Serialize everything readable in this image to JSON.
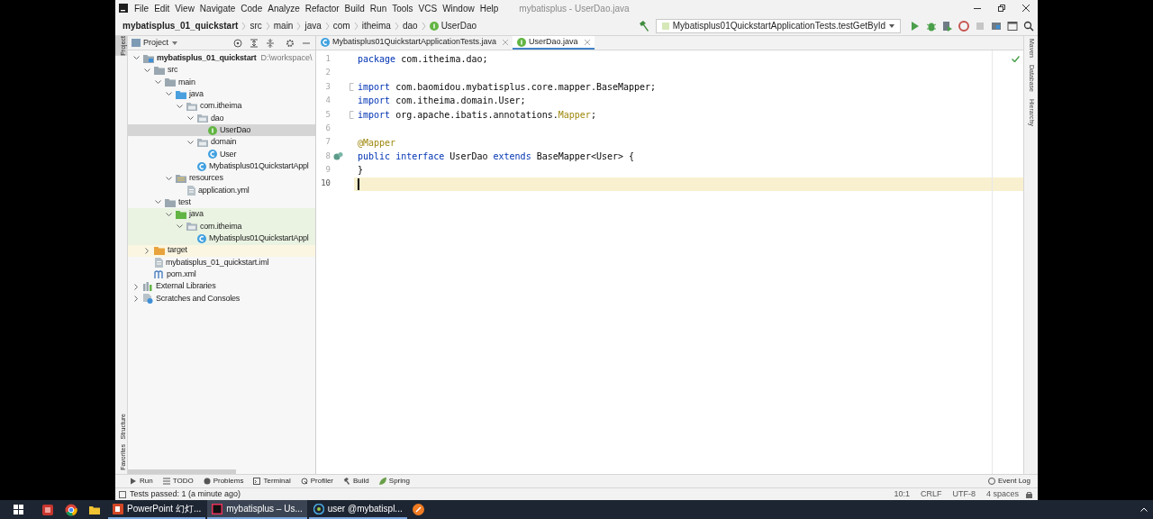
{
  "menu": [
    "File",
    "Edit",
    "View",
    "Navigate",
    "Code",
    "Analyze",
    "Refactor",
    "Build",
    "Run",
    "Tools",
    "VCS",
    "Window",
    "Help"
  ],
  "window": {
    "title": "mybatisplus - UserDao.java"
  },
  "breadcrumbs": [
    {
      "label": "mybatisplus_01_quickstart",
      "kind": "project"
    },
    {
      "label": "src",
      "kind": "folder"
    },
    {
      "label": "main",
      "kind": "folder"
    },
    {
      "label": "java",
      "kind": "folder"
    },
    {
      "label": "com",
      "kind": "folder"
    },
    {
      "label": "itheima",
      "kind": "folder"
    },
    {
      "label": "dao",
      "kind": "folder"
    },
    {
      "label": "UserDao",
      "kind": "interface"
    }
  ],
  "run_config": {
    "label": "Mybatisplus01QuickstartApplicationTests.testGetById"
  },
  "left_stripe_top": [
    {
      "label": "Project",
      "selected": true
    }
  ],
  "left_stripe_bottom": [
    {
      "label": "Structure",
      "selected": false
    },
    {
      "label": "Favorites",
      "selected": false
    }
  ],
  "project_panel": {
    "title": "Project",
    "tree": [
      {
        "label": "mybatisplus_01_quickstart",
        "kind": "module",
        "hint": "D:\\workspace\\",
        "expanded": true,
        "selected": false,
        "children": [
          {
            "label": "src",
            "kind": "folder",
            "expanded": true,
            "selected": false,
            "children": [
              {
                "label": "main",
                "kind": "folder",
                "expanded": true,
                "selected": false,
                "children": [
                  {
                    "label": "java",
                    "kind": "source-folder",
                    "expanded": true,
                    "selected": false,
                    "children": [
                      {
                        "label": "com.itheima",
                        "kind": "package",
                        "expanded": true,
                        "selected": false,
                        "children": [
                          {
                            "label": "dao",
                            "kind": "package",
                            "expanded": true,
                            "selected": false,
                            "children": [
                              {
                                "label": "UserDao",
                                "kind": "interface",
                                "selected": true
                              }
                            ]
                          },
                          {
                            "label": "domain",
                            "kind": "package",
                            "expanded": true,
                            "selected": false,
                            "children": [
                              {
                                "label": "User",
                                "kind": "class",
                                "selected": false
                              }
                            ]
                          },
                          {
                            "label": "Mybatisplus01QuickstartAppl",
                            "kind": "class",
                            "selected": false
                          }
                        ]
                      }
                    ]
                  },
                  {
                    "label": "resources",
                    "kind": "resources",
                    "expanded": true,
                    "selected": false,
                    "children": [
                      {
                        "label": "application.yml",
                        "kind": "file",
                        "selected": false
                      }
                    ]
                  }
                ]
              },
              {
                "label": "test",
                "kind": "folder",
                "expanded": true,
                "selected": false,
                "children": [
                  {
                    "label": "java",
                    "kind": "test-folder",
                    "color": "#eaf3e2",
                    "expanded": true,
                    "selected": false,
                    "children": [
                      {
                        "label": "com.itheima",
                        "kind": "package",
                        "color": "#eaf3e2",
                        "expanded": true,
                        "selected": false,
                        "children": [
                          {
                            "label": "Mybatisplus01QuickstartAppl",
                            "kind": "class",
                            "color": "#eaf3e2",
                            "selected": false
                          }
                        ]
                      }
                    ]
                  }
                ]
              }
            ]
          },
          {
            "label": "target",
            "kind": "excluded-folder",
            "color": "#fbf6e1",
            "expanded": false,
            "selected": false
          },
          {
            "label": "mybatisplus_01_quickstart.iml",
            "kind": "file",
            "selected": false
          },
          {
            "label": "pom.xml",
            "kind": "maven",
            "selected": false
          }
        ]
      },
      {
        "label": "External Libraries",
        "kind": "library",
        "expanded": false,
        "selected": false
      },
      {
        "label": "Scratches and Consoles",
        "kind": "scratches",
        "expanded": false,
        "selected": false
      }
    ]
  },
  "editor_tabs": [
    {
      "label": "Mybatisplus01QuickstartApplicationTests.java",
      "kind": "class",
      "selected": false
    },
    {
      "label": "UserDao.java",
      "kind": "interface",
      "selected": true
    }
  ],
  "code_lines": [
    {
      "number": "1",
      "fold": false,
      "marker": false,
      "current": false,
      "tokens": [
        {
          "text": "package",
          "kind": "keyword"
        },
        {
          "text": " com.itheima.dao;",
          "kind": "plain"
        }
      ]
    },
    {
      "number": "2",
      "fold": false,
      "marker": false,
      "current": false
    },
    {
      "number": "3",
      "fold": true,
      "marker": false,
      "current": false,
      "tokens": [
        {
          "text": "import",
          "kind": "keyword"
        },
        {
          "text": " com.baomidou.mybatisplus.core.mapper.BaseMapper;",
          "kind": "plain"
        }
      ]
    },
    {
      "number": "4",
      "fold": false,
      "marker": false,
      "current": false,
      "tokens": [
        {
          "text": "import",
          "kind": "keyword"
        },
        {
          "text": " com.itheima.domain.User;",
          "kind": "plain"
        }
      ]
    },
    {
      "number": "5",
      "fold": true,
      "marker": false,
      "current": false,
      "tokens": [
        {
          "text": "import",
          "kind": "keyword"
        },
        {
          "text": " org.apache.ibatis.annotations.",
          "kind": "plain"
        },
        {
          "text": "Mapper",
          "kind": "annotation"
        },
        {
          "text": ";",
          "kind": "plain"
        }
      ]
    },
    {
      "number": "6",
      "fold": false,
      "marker": false,
      "current": false
    },
    {
      "number": "7",
      "fold": false,
      "marker": false,
      "current": false,
      "tokens": [
        {
          "text": "@Mapper",
          "kind": "annotation"
        }
      ]
    },
    {
      "number": "8",
      "fold": false,
      "marker": true,
      "current": false,
      "tokens": [
        {
          "text": "public interface",
          "kind": "keyword"
        },
        {
          "text": " UserDao ",
          "kind": "plain"
        },
        {
          "text": "extends",
          "kind": "keyword"
        },
        {
          "text": " BaseMapper<User> {",
          "kind": "plain"
        }
      ]
    },
    {
      "number": "9",
      "fold": false,
      "marker": false,
      "current": false,
      "tokens": [
        {
          "text": "}",
          "kind": "plain"
        }
      ]
    },
    {
      "number": "10",
      "fold": false,
      "marker": false,
      "current": true
    }
  ],
  "right_stripe": [
    "Maven",
    "Database",
    "Hierarchy"
  ],
  "tool_buttons": [
    {
      "label": "Run",
      "kind": "run"
    },
    {
      "label": "TODO",
      "kind": "todo"
    },
    {
      "label": "Problems",
      "kind": "problems"
    },
    {
      "label": "Terminal",
      "kind": "terminal"
    },
    {
      "label": "Profiler",
      "kind": "profiler"
    },
    {
      "label": "Build",
      "kind": "build"
    },
    {
      "label": "Spring",
      "kind": "spring"
    }
  ],
  "event_log": "Event Log",
  "status_bar": {
    "message": "Tests passed: 1 (a minute ago)",
    "items": [
      "10:1",
      "CRLF",
      "UTF-8",
      "4 spaces"
    ]
  },
  "taskbar": [
    {
      "label": "PowerPoint 幻灯...",
      "kind": "presentation",
      "selected": false
    },
    {
      "label": "mybatisplus – Us...",
      "kind": "ide",
      "selected": true
    },
    {
      "label": "user @mybatispl...",
      "kind": "database",
      "selected": false
    }
  ]
}
